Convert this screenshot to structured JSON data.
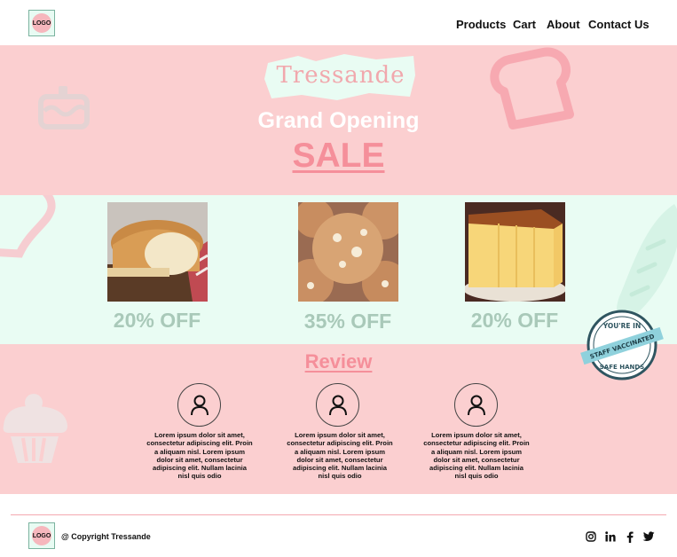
{
  "header": {
    "logo_label": "LOGO",
    "nav": [
      "Products",
      "Cart",
      "About",
      "Contact Us"
    ]
  },
  "hero": {
    "brand": "Tressande",
    "headline": "Grand Opening",
    "sale_label": "SALE"
  },
  "products": [
    {
      "image": "bread-loaf",
      "discount": "20% OFF"
    },
    {
      "image": "cookies",
      "discount": "35% OFF"
    },
    {
      "image": "sponge-cake",
      "discount": "20% OFF"
    }
  ],
  "badge": {
    "top": "YOU'RE IN",
    "ribbon": "STAFF VACCINATED",
    "bottom": "SAFE HANDS"
  },
  "review": {
    "title": "Review",
    "items": [
      {
        "icon": "user-icon",
        "text": "Lorem ipsum dolor sit amet, consectetur adipiscing elit. Proin a aliquam nisl. Lorem ipsum dolor sit amet, consectetur adipiscing elit. Nullam lacinia nisl quis odio"
      },
      {
        "icon": "user-icon",
        "text": "Lorem ipsum dolor sit amet, consectetur adipiscing elit. Proin a aliquam nisl. Lorem ipsum dolor sit amet, consectetur adipiscing elit. Nullam lacinia nisl quis odio"
      },
      {
        "icon": "user-icon",
        "text": "Lorem ipsum dolor sit amet, consectetur adipiscing elit. Proin a aliquam nisl. Lorem ipsum dolor sit amet, consectetur adipiscing elit. Nullam lacinia nisl quis odio"
      }
    ]
  },
  "footer": {
    "logo_label": "LOGO",
    "copyright": "@ Copyright Tressande",
    "social": [
      "instagram-icon",
      "linkedin-icon",
      "facebook-icon",
      "twitter-icon"
    ]
  },
  "colors": {
    "pink_band": "#fbcfd0",
    "mint_band": "#e9fcf3",
    "accent_pink": "#f58f9a",
    "discount_green": "#a9c9b9"
  }
}
